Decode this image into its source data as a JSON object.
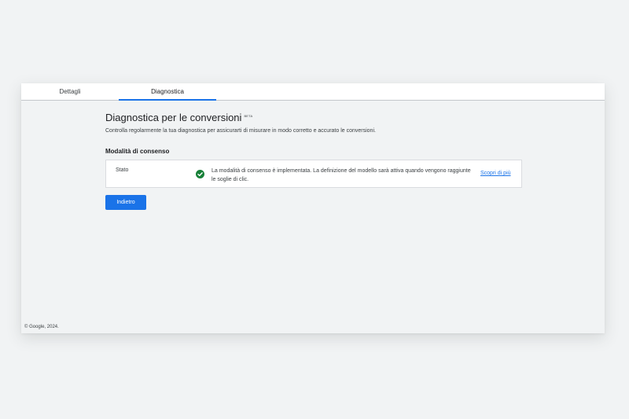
{
  "tabs": [
    {
      "label": "Dettagli",
      "active": false
    },
    {
      "label": "Diagnostica",
      "active": true
    }
  ],
  "page": {
    "title": "Diagnostica per le conversioni",
    "badge": "BETA",
    "subtitle": "Controlla regolarmente la tua diagnostica per assicurarti di misurare in modo corretto e accurato le conversioni."
  },
  "consent_section": {
    "title": "Modalità di consenso",
    "row": {
      "label": "Stato",
      "status_icon": "check-circle-icon",
      "status_color": "#188038",
      "message": "La modalità di consenso è implementata. La definizione del modello sarà attiva quando vengono raggiunte le soglie di clic.",
      "link": "Scopri di più"
    }
  },
  "actions": {
    "back_label": "Indietro"
  },
  "footer": {
    "copyright": "© Google, 2024."
  },
  "colors": {
    "accent": "#1a73e8",
    "background": "#f1f3f4"
  }
}
